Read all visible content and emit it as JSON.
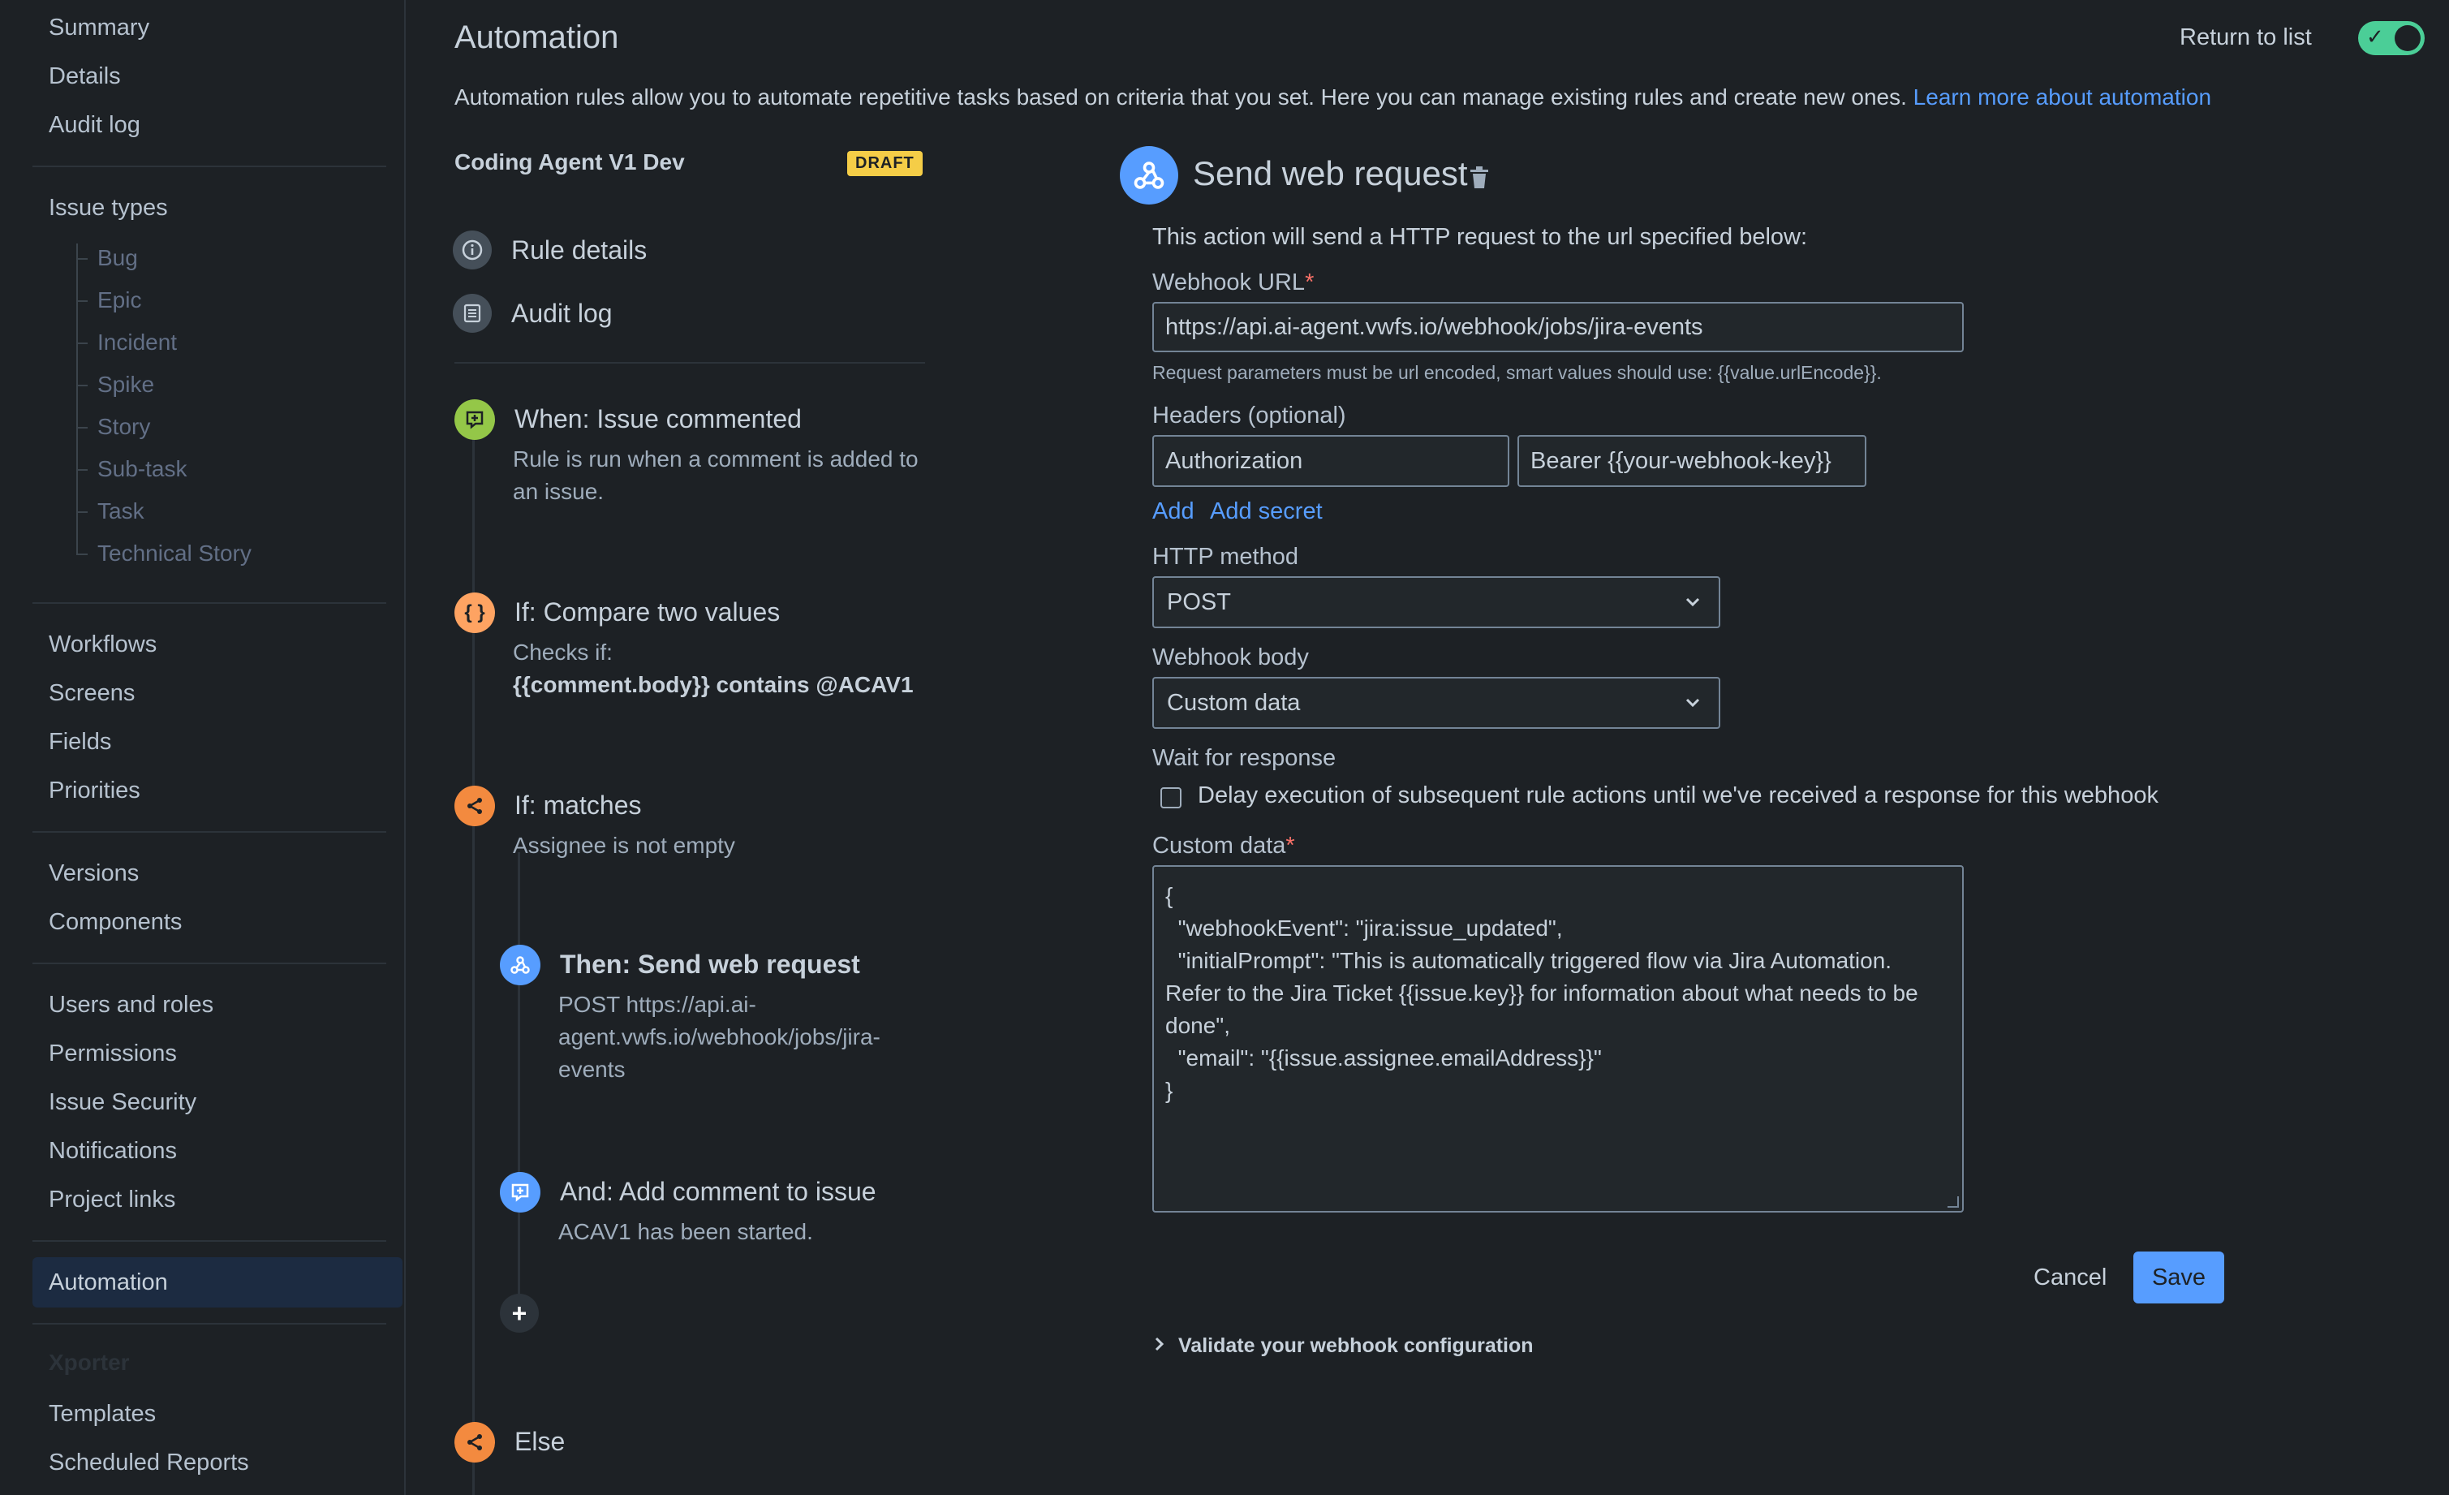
{
  "sidebar": {
    "top_items": [
      "Summary",
      "Details",
      "Audit log"
    ],
    "issue_types_heading": "Issue types",
    "issue_types": [
      "Bug",
      "Epic",
      "Incident",
      "Spike",
      "Story",
      "Sub-task",
      "Task",
      "Technical Story"
    ],
    "group2": [
      "Workflows",
      "Screens",
      "Fields",
      "Priorities"
    ],
    "group3": [
      "Versions",
      "Components"
    ],
    "group4": [
      "Users and roles",
      "Permissions",
      "Issue Security",
      "Notifications",
      "Project links"
    ],
    "selected": "Automation",
    "xporter_heading": "Xporter",
    "xporter_items": [
      "Templates",
      "Scheduled Reports"
    ]
  },
  "header": {
    "title": "Automation",
    "return_link": "Return to list",
    "toggle_on": true,
    "intro": "Automation rules allow you to automate repetitive tasks based on criteria that you set. Here you can manage existing rules and create new ones.",
    "intro_link": "Learn more about automation"
  },
  "rule": {
    "name": "Coding Agent V1 Dev",
    "badge": "DRAFT",
    "nav": [
      {
        "label": "Rule details",
        "icon": "info-icon"
      },
      {
        "label": "Audit log",
        "icon": "list-icon"
      }
    ],
    "steps": {
      "trigger": {
        "title": "When: Issue commented",
        "desc": "Rule is run when a comment is added to an issue.",
        "icon": "comment-icon"
      },
      "condition1": {
        "title": "If: Compare two values",
        "desc_prefix": "Checks if:",
        "desc_bold": "{{comment.body}} contains @ACAV1",
        "icon": "braces-icon"
      },
      "condition2": {
        "title": "If: matches",
        "desc": "Assignee is not empty",
        "icon": "branch-icon"
      },
      "action1": {
        "title": "Then: Send web request",
        "desc": "POST https://api.ai-agent.vwfs.io/webhook/jobs/jira-events",
        "icon": "webhook-icon"
      },
      "action2": {
        "title": "And: Add comment to issue",
        "desc": "ACAV1 has been started.",
        "icon": "comment-icon"
      },
      "else": {
        "title": "Else",
        "icon": "branch-icon"
      }
    }
  },
  "action": {
    "title": "Send web request",
    "intro": "This action will send a HTTP request to the url specified below:",
    "webhook_url_label": "Webhook URL",
    "webhook_url": "https://api.ai-agent.vwfs.io/webhook/jobs/jira-events",
    "helper": "Request parameters must be url encoded, smart values should use: {{value.urlEncode}}.",
    "headers_label": "Headers (optional)",
    "header_key": "Authorization",
    "header_value": "Bearer {{your-webhook-key}}",
    "add_link": "Add",
    "add_secret_link": "Add secret",
    "method_label": "HTTP method",
    "method_value": "POST",
    "body_label": "Webhook body",
    "body_value": "Custom data",
    "wait_label": "Wait for response",
    "wait_checkbox": "Delay execution of subsequent rule actions until we've received a response for this webhook",
    "custom_data_label": "Custom data",
    "custom_data": "{\n  \"webhookEvent\": \"jira:issue_updated\",\n  \"initialPrompt\": \"This is automatically triggered flow via Jira Automation. Refer to the Jira Ticket {{issue.key}} for information about what needs to be done\",\n  \"email\": \"{{issue.assignee.emailAddress}}\"\n}",
    "cancel": "Cancel",
    "save": "Save",
    "validate": "Validate your webhook configuration"
  }
}
